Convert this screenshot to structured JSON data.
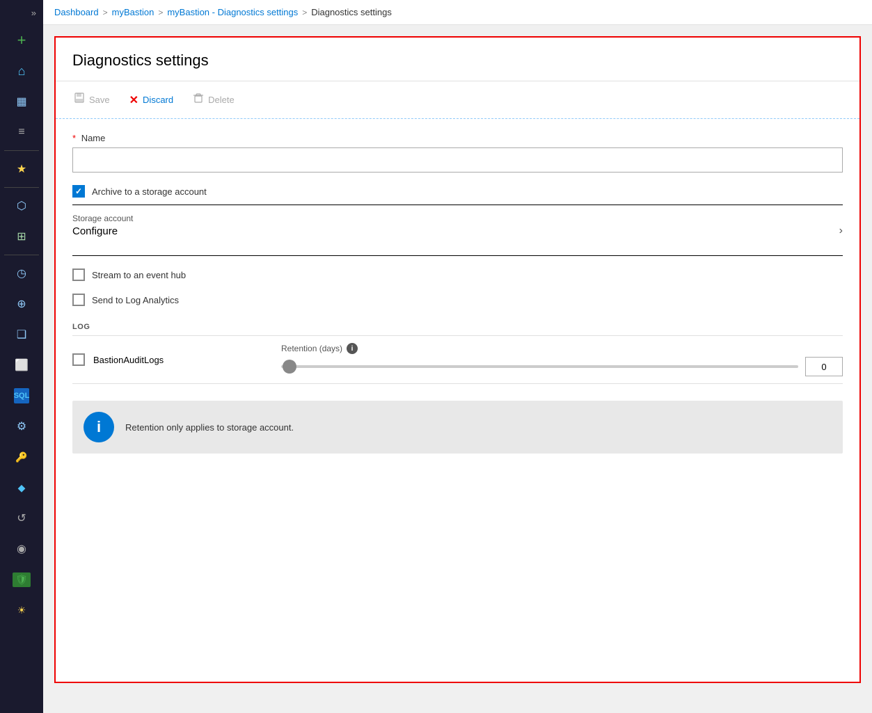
{
  "breadcrumb": {
    "items": [
      {
        "label": "Dashboard",
        "active": true
      },
      {
        "label": "myBastion",
        "active": true
      },
      {
        "label": "myBastion - Diagnostics settings",
        "active": true
      },
      {
        "label": "Diagnostics settings",
        "active": false
      }
    ],
    "separators": [
      ">",
      ">",
      ">"
    ]
  },
  "panel": {
    "title": "Diagnostics settings",
    "toolbar": {
      "save_label": "Save",
      "discard_label": "Discard",
      "delete_label": "Delete"
    },
    "form": {
      "name_label": "Name",
      "name_placeholder": "",
      "archive_label": "Archive to a storage account",
      "archive_checked": true,
      "storage_account_label": "Storage account",
      "storage_configure_text": "Configure",
      "stream_label": "Stream to an event hub",
      "stream_checked": false,
      "log_analytics_label": "Send to Log Analytics",
      "log_analytics_checked": false,
      "log_section_label": "LOG",
      "log_row": {
        "checkbox_checked": false,
        "name": "BastionAuditLogs",
        "retention_label": "Retention (days)",
        "retention_value": "0",
        "slider_value": 0
      },
      "info_banner_text": "Retention only applies to storage account."
    }
  },
  "sidebar": {
    "expand_icon": "»",
    "add_icon": "+",
    "icons": [
      {
        "name": "home",
        "symbol": "⌂",
        "class": "si-home"
      },
      {
        "name": "dashboard",
        "symbol": "▦",
        "class": "si-dashboard"
      },
      {
        "name": "menu",
        "symbol": "≡",
        "class": "si-menu"
      },
      {
        "name": "star",
        "symbol": "★",
        "class": "si-star"
      },
      {
        "name": "cube",
        "symbol": "⬡",
        "class": "si-cube"
      },
      {
        "name": "grid",
        "symbol": "⊞",
        "class": "si-grid"
      },
      {
        "name": "clock",
        "symbol": "◷",
        "class": "si-clock"
      },
      {
        "name": "globe",
        "symbol": "⊕",
        "class": "si-globe"
      },
      {
        "name": "box",
        "symbol": "❑",
        "class": "si-box"
      },
      {
        "name": "monitor",
        "symbol": "⬜",
        "class": "si-monitor"
      },
      {
        "name": "sql",
        "symbol": "S",
        "class": "si-sql"
      },
      {
        "name": "gear",
        "symbol": "⚙",
        "class": "si-gear"
      },
      {
        "name": "key",
        "symbol": "🔑",
        "class": "si-key"
      },
      {
        "name": "diamond",
        "symbol": "◆",
        "class": "si-diamond"
      },
      {
        "name": "circle-arrow",
        "symbol": "↺",
        "class": "si-circle-arrow"
      },
      {
        "name": "speedometer",
        "symbol": "◉",
        "class": "si-speedometer"
      },
      {
        "name": "shield",
        "symbol": "⛉",
        "class": "si-shield"
      },
      {
        "name": "sun",
        "symbol": "☀",
        "class": "si-sun"
      }
    ]
  }
}
